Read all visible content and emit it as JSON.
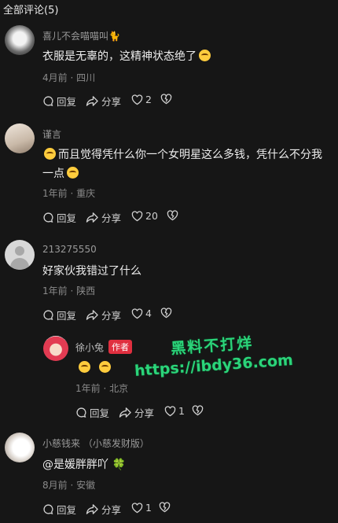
{
  "header": {
    "title": "全部评论(5)"
  },
  "actions": {
    "reply": "回复",
    "share": "分享"
  },
  "comments": [
    {
      "name": "喜儿不会喵喵叫🐈",
      "text": "衣服是无辜的，这精神状态绝了",
      "meta": "4月前 · 四川",
      "likes": "2"
    },
    {
      "name": "谨言",
      "text_line1": "而且觉得凭什么你一个女明星这么多钱，凭什么不分我",
      "text_line2": "一点",
      "meta": "1年前 · 重庆",
      "likes": "20"
    },
    {
      "name": "213275550",
      "text": "好家伙我错过了什么",
      "meta": "1年前 · 陕西",
      "likes": "4"
    },
    {
      "name": "徐小兔",
      "badge": "作者",
      "meta": "1年前 · 北京",
      "likes": "1"
    },
    {
      "name": "小慈钱来 （小慈发财版）",
      "text": "@是媛胖胖吖 🍀",
      "meta": "8月前 · 安徽",
      "likes": "1"
    }
  ],
  "watermark": {
    "line1": "黑料不打烊",
    "line2": "https://ibdy36.com"
  }
}
